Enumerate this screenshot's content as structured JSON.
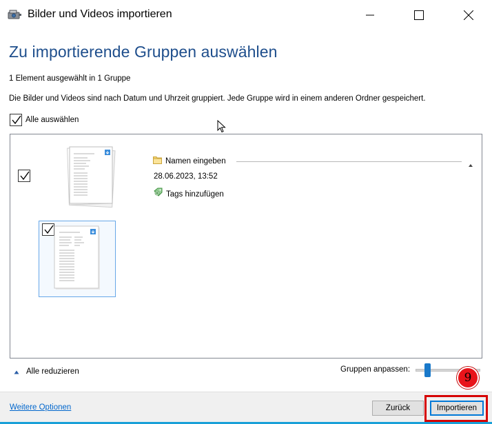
{
  "window": {
    "title": "Bilder und Videos importieren"
  },
  "main": {
    "heading": "Zu importierende Gruppen auswählen",
    "selection_info": "1 Element ausgewählt in 1 Gruppe",
    "description": "Die Bilder und Videos sind nach Datum und Uhrzeit gruppiert. Jede Gruppe wird in einem anderen Ordner gespeichert.",
    "select_all_label": "Alle auswählen",
    "select_all_checked": true
  },
  "group": {
    "checked": true,
    "folder_name_placeholder": "Namen eingeben",
    "datetime": "28.06.2023, 13:52",
    "add_tags_label": "Tags hinzufügen",
    "items": [
      {
        "checked": true,
        "selected": true
      }
    ]
  },
  "controls": {
    "collapse_all_label": "Alle reduzieren",
    "adjust_groups_label": "Gruppen anpassen:",
    "adjust_groups_level": 0.15
  },
  "footer": {
    "more_options_label": "Weitere Optionen",
    "back_button_label": "Zurück",
    "import_button_label": "Importieren"
  },
  "annotation": {
    "step_number": "9",
    "highlight_color": "#d60000"
  },
  "colors": {
    "heading": "#1e4e8c",
    "link": "#0066cc",
    "accent": "#1979ca"
  }
}
